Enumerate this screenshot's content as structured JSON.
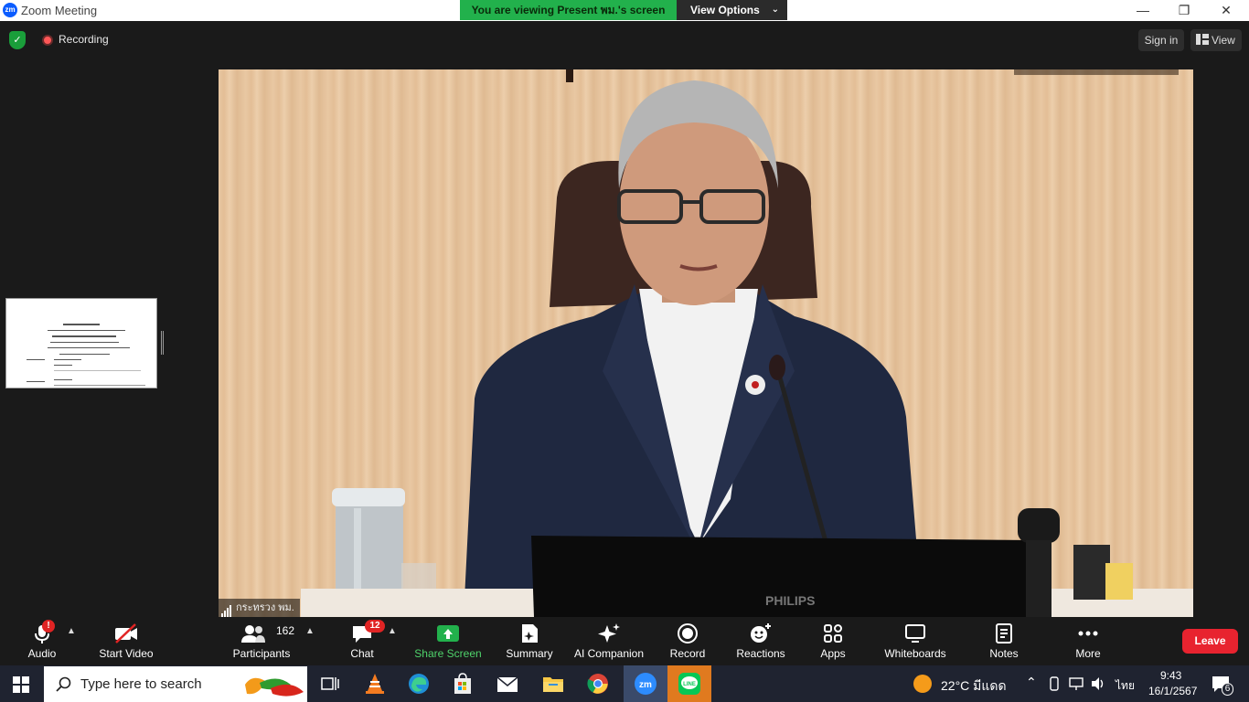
{
  "window": {
    "app_title": "Zoom Meeting",
    "logo_text": "zm",
    "viewing_banner": "You are viewing Present พม.'s screen",
    "view_options_label": "View Options",
    "minimize_glyph": "—",
    "maximize_glyph": "❐",
    "close_glyph": "✕"
  },
  "meeting_header": {
    "recording_label": "Recording",
    "signin_label": "Sign in",
    "view_label": "View"
  },
  "video": {
    "participant_name": "กระทรวง พม.",
    "monitor_brand": "PHILIPS"
  },
  "toolbar": {
    "audio": {
      "label": "Audio",
      "alert": "!"
    },
    "start_video": {
      "label": "Start Video"
    },
    "participants": {
      "label": "Participants",
      "count": "162"
    },
    "chat": {
      "label": "Chat",
      "badge": "12"
    },
    "share_screen": {
      "label": "Share Screen"
    },
    "summary": {
      "label": "Summary"
    },
    "ai_companion": {
      "label": "AI Companion"
    },
    "record": {
      "label": "Record"
    },
    "reactions": {
      "label": "Reactions"
    },
    "apps": {
      "label": "Apps"
    },
    "whiteboards": {
      "label": "Whiteboards"
    },
    "notes": {
      "label": "Notes"
    },
    "more": {
      "label": "More"
    },
    "leave": {
      "label": "Leave"
    }
  },
  "taskbar": {
    "search_placeholder": "Type here to search",
    "weather": "22°C  มีแดด",
    "language": "ไทย",
    "time": "9:43",
    "date": "16/1/2567",
    "notification_count": "6",
    "apps": [
      "task-view",
      "vlc",
      "edge",
      "store",
      "mail",
      "file-explorer",
      "chrome",
      "zoom",
      "line"
    ],
    "colors": {
      "accent": "#0b5cff",
      "green": "#22b14c",
      "leave": "#e8232f"
    }
  }
}
